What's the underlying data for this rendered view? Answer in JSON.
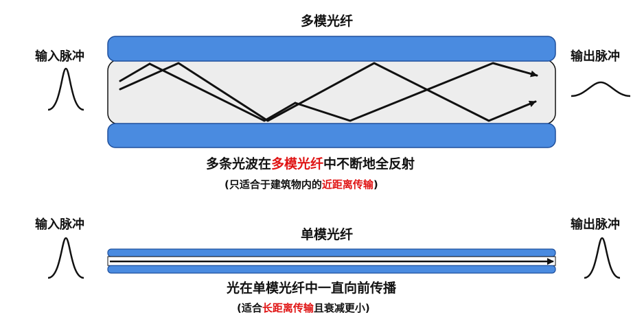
{
  "multimode": {
    "title": "多模光纤",
    "input_label": "输入脉冲",
    "output_label": "输出脉冲",
    "caption": {
      "pre": "多条光波在",
      "highlight": "多模光纤",
      "post": "中不断地全反射"
    },
    "note": {
      "pre": "(只适合于建筑物内的",
      "highlight": "近距离传输",
      "post": ")"
    }
  },
  "singlemode": {
    "title": "单模光纤",
    "input_label": "输入脉冲",
    "output_label": "输出脉冲",
    "caption": "光在单模光纤中一直向前传播",
    "note": {
      "pre": "(适合",
      "highlight": "长距离传输",
      "post": "且衰减更小)"
    }
  },
  "colors": {
    "cladding": "#4a8be0",
    "core": "#ededed",
    "highlight": "#e01414",
    "stroke": "#111111"
  }
}
